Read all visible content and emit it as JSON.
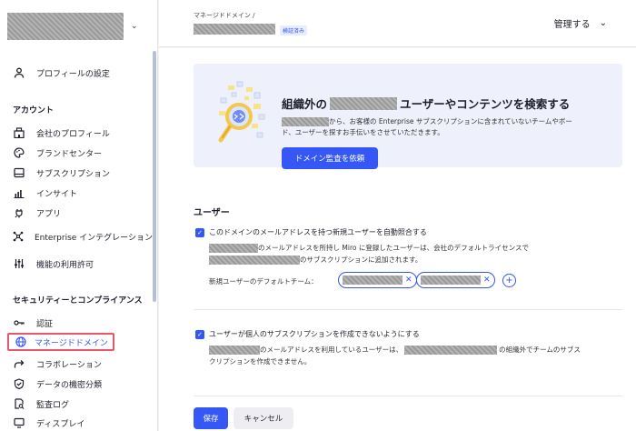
{
  "sidebar": {
    "org_caret": "⌄",
    "profile_settings": "プロフィールの設定",
    "account_header": "アカウント",
    "account_items": [
      "会社のプロフィール",
      "ブランドセンター",
      "サブスクリプション",
      "インサイト",
      "アプリ",
      "Enterprise インテグレーション",
      "機能の利用許可"
    ],
    "security_header": "セキュリティーとコンプライアンス",
    "security_items": [
      "認証",
      "マネージドドメイン",
      "コラボレーション",
      "データの機密分類",
      "監査ログ",
      "ディスプレイ"
    ]
  },
  "header": {
    "breadcrumb": "マネージドドメイン /",
    "verified_badge": "検証済み",
    "manage_label": "管理する",
    "manage_chevron": "⌄"
  },
  "banner": {
    "title_prefix": "組織外の",
    "title_suffix": "ユーザーやコンテンツを検索する",
    "desc_line1": "から、お客様の Enterprise サブスクリプションに含まれていないチームやボー",
    "desc_line2": "ド、ユーザーを探すお手伝いをさせていただきます。",
    "button": "ドメイン監査を依頼"
  },
  "users": {
    "header": "ユーザー",
    "opt1_label": "このドメインのメールアドレスを持つ新規ユーザーを自動照合する",
    "opt1_desc_line1": "のメールアドレスを所持し Miro に登録したユーザーは、会社のデフォルトライセンスで",
    "opt1_desc_line2": "のサブスクリプションに追加されます。",
    "default_team_label": "新規ユーザーのデフォルトチーム：",
    "chip_close": "✕",
    "add_symbol": "+",
    "opt2_label": "ユーザーが個人のサブスクリプションを作成できないようにする",
    "opt2_desc_line1a": "のメールアドレスを利用しているユーザーは、",
    "opt2_desc_line1b": "の組織外でチームのサブス",
    "opt2_desc_line2": "クリプションを作成できません。"
  },
  "footer": {
    "save": "保存",
    "cancel": "キャンセル"
  },
  "colors": {
    "accent": "#3457f5",
    "highlight": "#e9556b"
  }
}
